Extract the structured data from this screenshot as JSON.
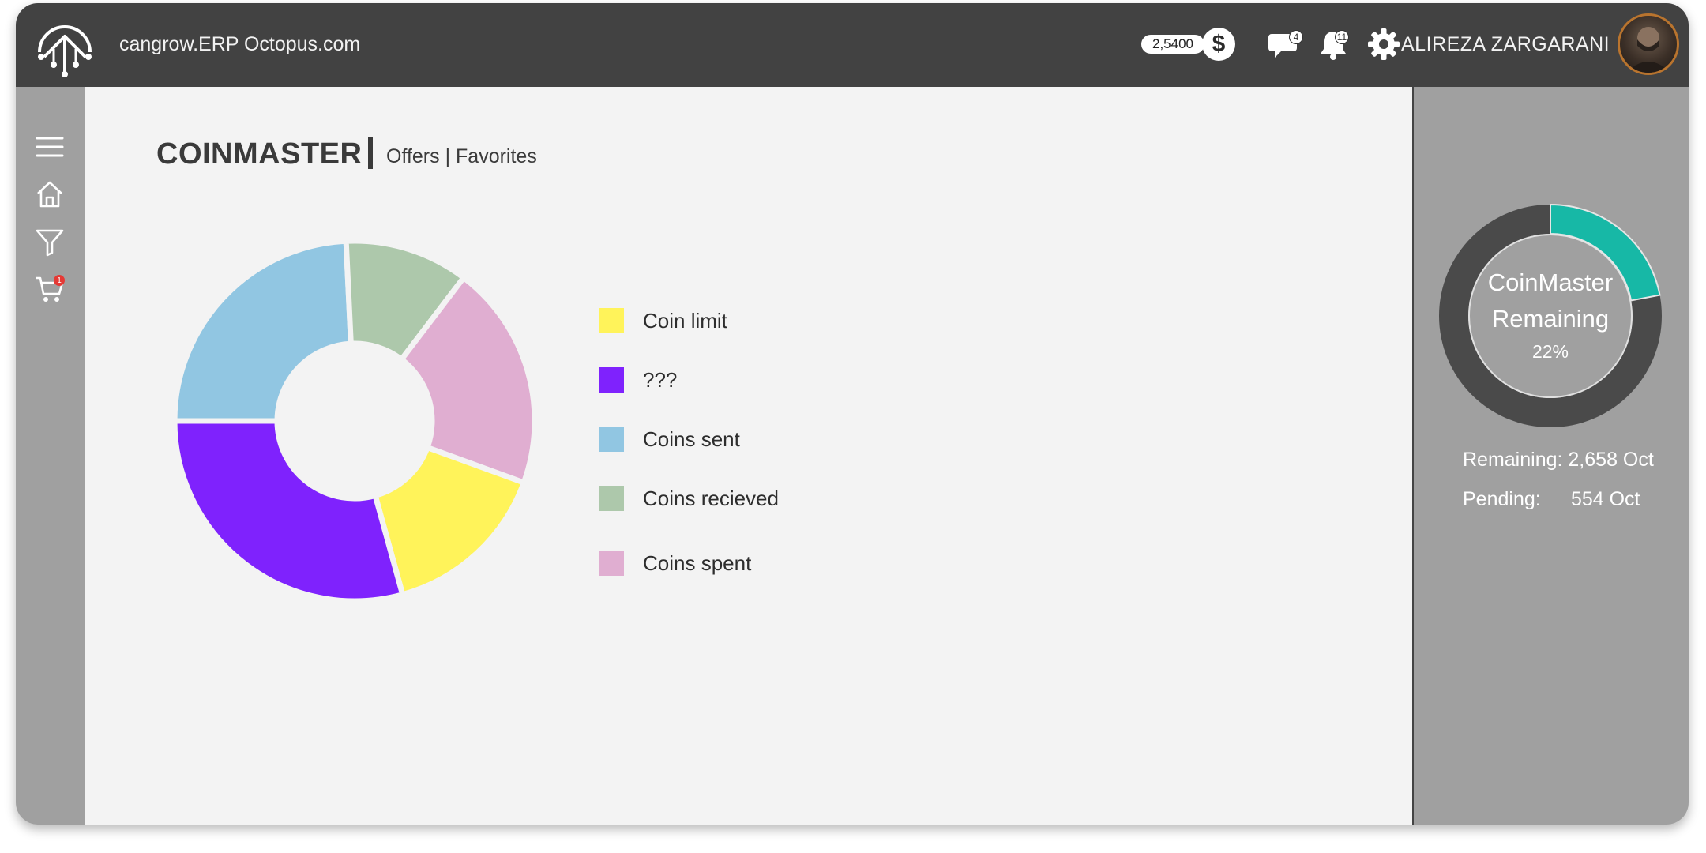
{
  "header": {
    "site_title": "cangrow.ERP Octopus.com",
    "coin_balance": "2,5400",
    "coin_icon_glyph": "$",
    "messages_badge": "4",
    "notifications_badge": "11",
    "user_name": "ALIREZA ZARGARANI",
    "colors": {
      "bar": "#424242",
      "text": "#f2f2f2"
    }
  },
  "sidebar": {
    "items": [
      {
        "name": "menu",
        "icon": "hamburger-menu-icon"
      },
      {
        "name": "home",
        "icon": "home-icon"
      },
      {
        "name": "filter",
        "icon": "filter-icon"
      },
      {
        "name": "cart",
        "icon": "cart-icon",
        "badge": "1"
      }
    ]
  },
  "main": {
    "title": "COINMASTER",
    "links": {
      "offers": "Offers",
      "separator": "|",
      "favorites": "Favorites"
    }
  },
  "chart_data": {
    "type": "pie",
    "style": "donut",
    "legend_position": "right",
    "slices": [
      {
        "label": "Coin limit",
        "value": 15,
        "color": "#fff35a"
      },
      {
        "label": "???",
        "value": 29,
        "color": "#7f22fd"
      },
      {
        "label": "Coins sent",
        "value": 24,
        "color": "#91c6e2"
      },
      {
        "label": "Coins recieved",
        "value": 11,
        "color": "#adc8ab"
      },
      {
        "label": "Coins spent",
        "value": 20,
        "color": "#e0aed1"
      }
    ]
  },
  "right_panel": {
    "ring_title_line1": "CoinMaster",
    "ring_title_line2": "Remaining",
    "remaining_fraction": 0.22,
    "remaining_percent_label": "22%",
    "remaining_label": "Remaining:",
    "remaining_value": "2,658 Oct",
    "pending_label": "Pending:",
    "pending_value": "554 Oct",
    "colors": {
      "ring_track": "#4a4a4a",
      "ring_fill": "#17b8a6"
    }
  }
}
